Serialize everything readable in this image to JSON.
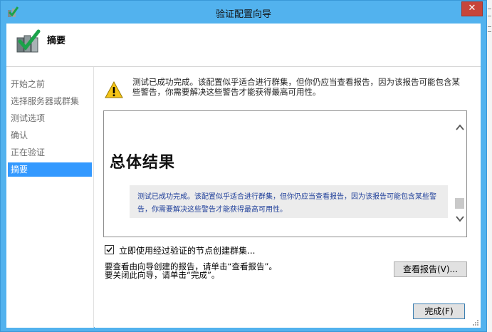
{
  "window": {
    "title": "验证配置向导",
    "close_symbol": "✕"
  },
  "header": {
    "title": "摘要",
    "icon": "validate-cluster-icon"
  },
  "nav": {
    "items": [
      {
        "label": "开始之前",
        "active": false
      },
      {
        "label": "选择服务器或群集",
        "active": false
      },
      {
        "label": "测试选项",
        "active": false
      },
      {
        "label": "确认",
        "active": false
      },
      {
        "label": "正在验证",
        "active": false
      },
      {
        "label": "摘要",
        "active": true
      }
    ]
  },
  "summary": {
    "warning_icon": "warning-icon",
    "warning_text": "测试已成功完成。该配置似乎适合进行群集，但你仍应当查看报告，因为该报告可能包含某些警告，你需要解决这些警告才能获得最高可用性。"
  },
  "report": {
    "heading": "总体结果",
    "result_text": "测试已成功完成。该配置似乎适合进行群集，但你仍应当查看报告，因为该报告可能包含某些警告，你需要解决这些警告才能获得最高可用性。",
    "result_color": "#1f3f9a"
  },
  "options": {
    "create_cluster_label": "立即使用经过验证的节点创建群集...",
    "create_cluster_checked": true
  },
  "info": {
    "view_report_hint": "要查看由向导创建的报告，请单击“查看报告”。",
    "close_hint": "要关闭此向导，请单击“完成”。"
  },
  "buttons": {
    "view_report": "查看报告(V)...",
    "finish": "完成(F)"
  },
  "colors": {
    "titlebar": "#52b2ee",
    "close_button": "#c7453a",
    "nav_selected": "#3399ff"
  }
}
